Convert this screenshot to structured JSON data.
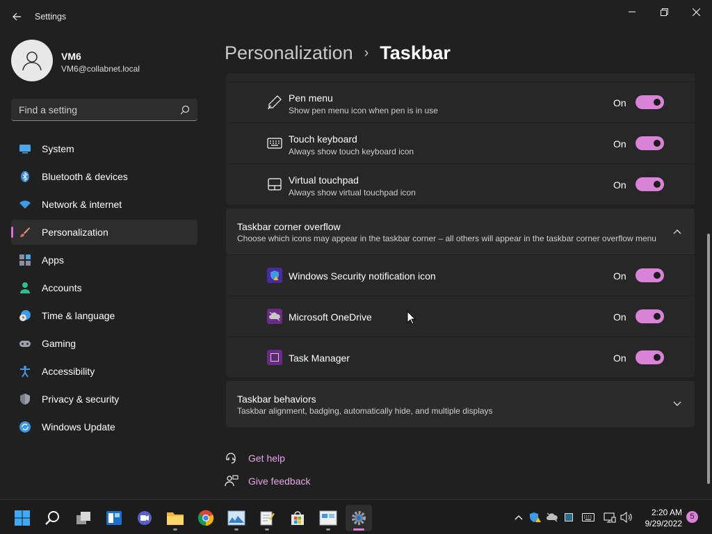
{
  "window": {
    "title": "Settings"
  },
  "user": {
    "name": "VM6",
    "email": "VM6@collabnet.local"
  },
  "search": {
    "placeholder": "Find a setting"
  },
  "sidebar": {
    "items": [
      {
        "label": "System",
        "icon": "system-icon"
      },
      {
        "label": "Bluetooth & devices",
        "icon": "bluetooth-icon"
      },
      {
        "label": "Network & internet",
        "icon": "wifi-icon"
      },
      {
        "label": "Personalization",
        "icon": "brush-icon",
        "active": true
      },
      {
        "label": "Apps",
        "icon": "apps-icon"
      },
      {
        "label": "Accounts",
        "icon": "accounts-icon"
      },
      {
        "label": "Time & language",
        "icon": "clock-globe-icon"
      },
      {
        "label": "Gaming",
        "icon": "gamepad-icon"
      },
      {
        "label": "Accessibility",
        "icon": "accessibility-icon"
      },
      {
        "label": "Privacy & security",
        "icon": "shield-icon"
      },
      {
        "label": "Windows Update",
        "icon": "update-icon"
      }
    ]
  },
  "breadcrumb": {
    "parent": "Personalization",
    "separator": "›",
    "current": "Taskbar"
  },
  "system_tray_icons": {
    "rows": [
      {
        "title": "Pen menu",
        "description": "Show pen menu icon when pen is in use",
        "state": "On",
        "icon": "pen-icon"
      },
      {
        "title": "Touch keyboard",
        "description": "Always show touch keyboard icon",
        "state": "On",
        "icon": "keyboard-icon"
      },
      {
        "title": "Virtual touchpad",
        "description": "Always show virtual touchpad icon",
        "state": "On",
        "icon": "touchpad-icon"
      }
    ]
  },
  "corner_overflow": {
    "title": "Taskbar corner overflow",
    "description": "Choose which icons may appear in the taskbar corner – all others will appear in the taskbar corner overflow menu",
    "expanded": true,
    "rows": [
      {
        "title": "Windows Security notification icon",
        "state": "On",
        "icon": "windows-security-icon"
      },
      {
        "title": "Microsoft OneDrive",
        "state": "On",
        "icon": "onedrive-icon"
      },
      {
        "title": "Task Manager",
        "state": "On",
        "icon": "task-manager-icon"
      }
    ]
  },
  "behaviors": {
    "title": "Taskbar behaviors",
    "description": "Taskbar alignment, badging, automatically hide, and multiple displays",
    "expanded": false
  },
  "help": {
    "get_help": "Get help",
    "give_feedback": "Give feedback"
  },
  "taskbar": {
    "apps": [
      "start",
      "search",
      "task-view",
      "widgets",
      "teams-chat",
      "file-explorer",
      "chrome",
      "photos",
      "notepad",
      "microsoft-store",
      "control-panel",
      "settings"
    ],
    "clock_time": "2:20 AM",
    "clock_date": "9/29/2022",
    "notification_count": "5"
  },
  "colors": {
    "accent": "#d882d8",
    "link": "#e7a6e7",
    "background": "#202020",
    "card": "#2b2b2b"
  }
}
